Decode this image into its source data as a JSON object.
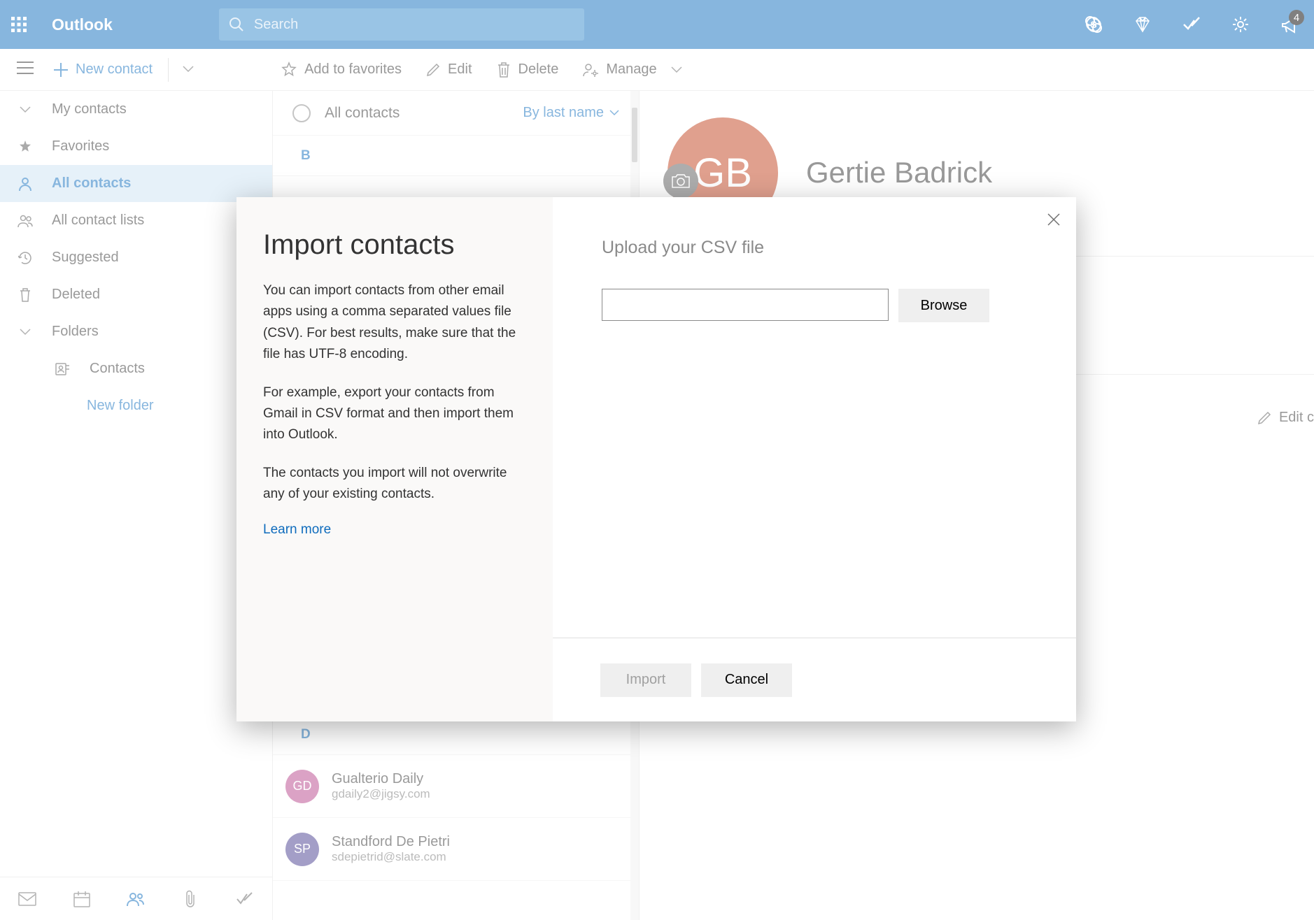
{
  "header": {
    "brand": "Outlook",
    "search_placeholder": "Search",
    "notification_count": "4"
  },
  "toolbar": {
    "new_contact": "New contact",
    "add_favorites": "Add to favorites",
    "edit": "Edit",
    "delete": "Delete",
    "manage": "Manage"
  },
  "sidebar": {
    "my_contacts": "My contacts",
    "favorites": "Favorites",
    "all_contacts": "All contacts",
    "all_contact_lists": "All contact lists",
    "suggested": "Suggested",
    "deleted": "Deleted",
    "folders": "Folders",
    "contacts_folder": "Contacts",
    "new_folder": "New folder"
  },
  "list": {
    "title": "All contacts",
    "sort": "By last name",
    "groups": [
      {
        "letter": "B"
      },
      {
        "letter": "D"
      }
    ],
    "contacts": [
      {
        "initials": "GD",
        "name": "Gualterio Daily",
        "email": "gdaily2@jigsy.com",
        "color": "#b6458a"
      },
      {
        "initials": "SP",
        "name": "Standford De Pietri",
        "email": "sdepietrid@slate.com",
        "color": "#473d8f"
      }
    ]
  },
  "detail": {
    "initials": "GB",
    "name": "Gertie Badrick",
    "edit_contact": "Edit c"
  },
  "modal": {
    "title": "Import contacts",
    "p1": "You can import contacts from other email apps using a comma separated values file (CSV). For best results, make sure that the file has UTF-8 encoding.",
    "p2": "For example, export your contacts from Gmail in CSV format and then import them into Outlook.",
    "p3": "The contacts you import will not overwrite any of your existing contacts.",
    "learn_more": "Learn more",
    "upload_title": "Upload your CSV file",
    "browse": "Browse",
    "import": "Import",
    "cancel": "Cancel"
  }
}
